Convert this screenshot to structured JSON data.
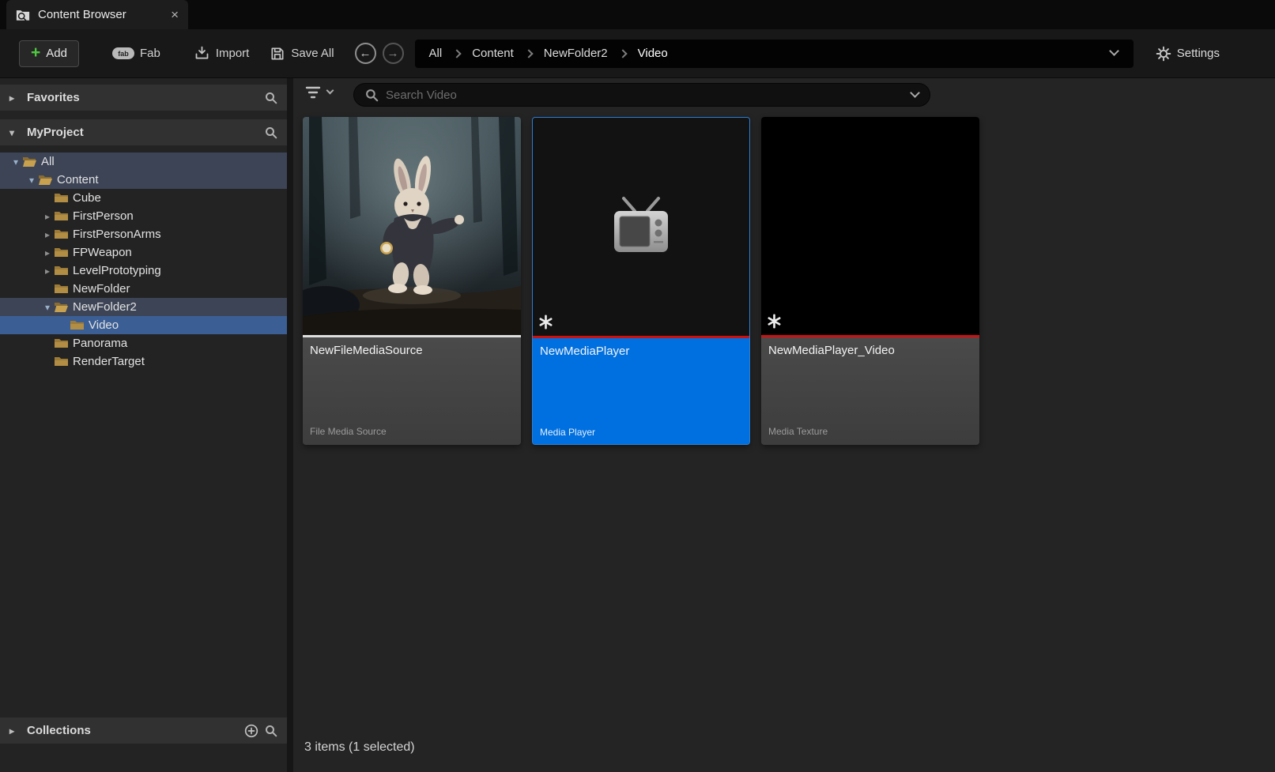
{
  "window": {
    "tab_title": "Content Browser"
  },
  "icons": {
    "close_glyph": "×",
    "back_glyph": "←",
    "forward_glyph": "→",
    "expanded_glyph": "▾",
    "collapsed_glyph": "▸",
    "fab_logo": "fab"
  },
  "toolbar": {
    "add_label": "Add",
    "fab_label": "Fab",
    "import_label": "Import",
    "save_all_label": "Save All",
    "settings_label": "Settings",
    "breadcrumbs": [
      "All",
      "Content",
      "NewFolder2",
      "Video"
    ]
  },
  "sidebar": {
    "favorites_label": "Favorites",
    "project_label": "MyProject",
    "collections_label": "Collections",
    "tree": [
      "All",
      "Content",
      "Cube",
      "FirstPerson",
      "FirstPersonArms",
      "FPWeapon",
      "LevelPrototyping",
      "NewFolder",
      "NewFolder2",
      "Video",
      "Panorama",
      "RenderTarget"
    ]
  },
  "main": {
    "search_placeholder": "Search Video",
    "status_text": "3 items (1 selected)",
    "assets": [
      {
        "name": "NewFileMediaSource",
        "type": "File Media Source"
      },
      {
        "name": "NewMediaPlayer",
        "type": "Media Player"
      },
      {
        "name": "NewMediaPlayer_Video",
        "type": "Media Texture"
      }
    ]
  },
  "colors": {
    "selection_blue": "#0070e0",
    "add_green": "#4fc93f",
    "media_bar_red": "#cc1111",
    "source_bar_white": "#dedede",
    "folder_gold": "#bf9b4f"
  }
}
